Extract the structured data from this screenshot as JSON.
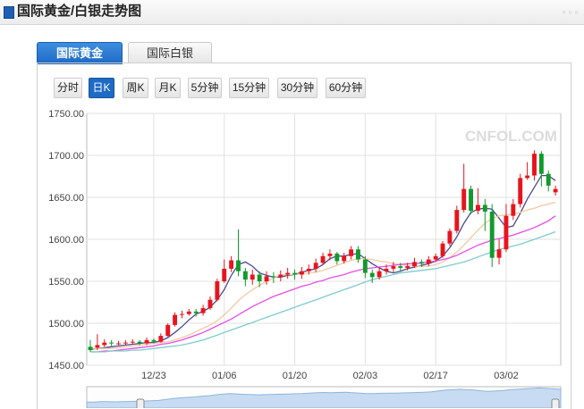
{
  "header": {
    "title": "国际黄金/白银走势图"
  },
  "tabs": [
    {
      "label": "国际黄金",
      "active": true
    },
    {
      "label": "国际白银",
      "active": false
    }
  ],
  "periods": [
    {
      "label": "分时",
      "active": false
    },
    {
      "label": "日K",
      "active": true
    },
    {
      "label": "周K",
      "active": false
    },
    {
      "label": "月K",
      "active": false
    },
    {
      "label": "5分钟",
      "active": false
    },
    {
      "label": "15分钟",
      "active": false
    },
    {
      "label": "30分钟",
      "active": false
    },
    {
      "label": "60分钟",
      "active": false
    }
  ],
  "watermark": {
    "brand": "CNFOL.COM"
  },
  "colors": {
    "up": "#e8141c",
    "down": "#119a2b",
    "ma5": "#4b4b8f",
    "ma10": "#f2c9a0",
    "ma20": "#e84ce8",
    "ma30": "#7ccccc",
    "accent": "#1f6ac4"
  },
  "chart_data": {
    "type": "candlestick",
    "ylim": [
      1450,
      1750
    ],
    "yticks": [
      "1450.00",
      "1500.00",
      "1550.00",
      "1600.00",
      "1650.00",
      "1700.00",
      "1750.00"
    ],
    "xticks": [
      {
        "label": "12/23",
        "index": 9
      },
      {
        "label": "01/06",
        "index": 19
      },
      {
        "label": "01/20",
        "index": 29
      },
      {
        "label": "02/03",
        "index": 39
      },
      {
        "label": "02/17",
        "index": 49
      },
      {
        "label": "03/02",
        "index": 59
      }
    ],
    "candles": [
      [
        1472,
        1468,
        1480,
        1466
      ],
      [
        1471,
        1474,
        1487,
        1468
      ],
      [
        1474,
        1477,
        1481,
        1472
      ],
      [
        1477,
        1476,
        1480,
        1473
      ],
      [
        1476,
        1476,
        1479,
        1474
      ],
      [
        1476,
        1477,
        1480,
        1474
      ],
      [
        1477,
        1478,
        1481,
        1475
      ],
      [
        1478,
        1476,
        1480,
        1474
      ],
      [
        1476,
        1480,
        1483,
        1474
      ],
      [
        1480,
        1478,
        1482,
        1476
      ],
      [
        1478,
        1485,
        1488,
        1477
      ],
      [
        1485,
        1498,
        1500,
        1484
      ],
      [
        1498,
        1510,
        1513,
        1496
      ],
      [
        1510,
        1511,
        1515,
        1506
      ],
      [
        1511,
        1514,
        1517,
        1509
      ],
      [
        1514,
        1512,
        1517,
        1508
      ],
      [
        1512,
        1518,
        1522,
        1509
      ],
      [
        1518,
        1528,
        1532,
        1516
      ],
      [
        1528,
        1550,
        1553,
        1526
      ],
      [
        1550,
        1565,
        1576,
        1548
      ],
      [
        1565,
        1575,
        1580,
        1561
      ],
      [
        1575,
        1562,
        1612,
        1556
      ],
      [
        1562,
        1552,
        1566,
        1544
      ],
      [
        1552,
        1558,
        1564,
        1546
      ],
      [
        1558,
        1550,
        1562,
        1543
      ],
      [
        1550,
        1556,
        1562,
        1546
      ],
      [
        1556,
        1555,
        1561,
        1548
      ],
      [
        1555,
        1558,
        1563,
        1550
      ],
      [
        1558,
        1560,
        1566,
        1553
      ],
      [
        1560,
        1558,
        1564,
        1552
      ],
      [
        1558,
        1562,
        1567,
        1553
      ],
      [
        1562,
        1565,
        1570,
        1558
      ],
      [
        1565,
        1572,
        1577,
        1561
      ],
      [
        1572,
        1580,
        1584,
        1570
      ],
      [
        1580,
        1583,
        1588,
        1575
      ],
      [
        1583,
        1574,
        1585,
        1570
      ],
      [
        1574,
        1580,
        1584,
        1571
      ],
      [
        1580,
        1588,
        1592,
        1576
      ],
      [
        1588,
        1576,
        1592,
        1572
      ],
      [
        1576,
        1560,
        1580,
        1554
      ],
      [
        1560,
        1555,
        1564,
        1548
      ],
      [
        1555,
        1562,
        1567,
        1552
      ],
      [
        1562,
        1565,
        1570,
        1558
      ],
      [
        1565,
        1568,
        1573,
        1561
      ],
      [
        1568,
        1566,
        1572,
        1562
      ],
      [
        1566,
        1568,
        1572,
        1563
      ],
      [
        1568,
        1573,
        1578,
        1566
      ],
      [
        1573,
        1571,
        1576,
        1567
      ],
      [
        1571,
        1576,
        1580,
        1568
      ],
      [
        1576,
        1580,
        1583,
        1573
      ],
      [
        1580,
        1595,
        1598,
        1578
      ],
      [
        1595,
        1610,
        1613,
        1592
      ],
      [
        1610,
        1635,
        1640,
        1607
      ],
      [
        1635,
        1660,
        1690,
        1632
      ],
      [
        1660,
        1634,
        1664,
        1630
      ],
      [
        1634,
        1641,
        1661,
        1630
      ],
      [
        1641,
        1633,
        1648,
        1610
      ],
      [
        1633,
        1578,
        1642,
        1567
      ],
      [
        1578,
        1588,
        1600,
        1570
      ],
      [
        1588,
        1628,
        1642,
        1585
      ],
      [
        1628,
        1642,
        1648,
        1623
      ],
      [
        1642,
        1673,
        1678,
        1638
      ],
      [
        1673,
        1676,
        1692,
        1671
      ],
      [
        1676,
        1702,
        1706,
        1670
      ],
      [
        1702,
        1678,
        1705,
        1663
      ],
      [
        1678,
        1664,
        1682,
        1657
      ],
      [
        1656,
        1660,
        1664,
        1652
      ]
    ],
    "ma_series": [
      {
        "key": "ma5",
        "values": [
          1469,
          1470,
          1471,
          1472,
          1473,
          1474,
          1475,
          1476,
          1477,
          1477,
          1479,
          1483,
          1489,
          1496,
          1504,
          1511,
          1514,
          1519,
          1528,
          1540,
          1557,
          1570,
          1573,
          1568,
          1560,
          1557,
          1555,
          1555,
          1557,
          1558,
          1561,
          1563,
          1565,
          1570,
          1577,
          1580,
          1580,
          1582,
          1583,
          1577,
          1571,
          1566,
          1562,
          1560,
          1562,
          1565,
          1567,
          1569,
          1571,
          1574,
          1580,
          1590,
          1603,
          1619,
          1632,
          1636,
          1637,
          1636,
          1625,
          1614,
          1616,
          1631,
          1648,
          1662,
          1676,
          1676,
          1670
        ]
      },
      {
        "key": "ma10",
        "values": [
          1470,
          1470,
          1470,
          1470,
          1471,
          1472,
          1473,
          1474,
          1475,
          1476,
          1477,
          1478,
          1480,
          1483,
          1486,
          1490,
          1494,
          1498,
          1503,
          1510,
          1518,
          1527,
          1534,
          1540,
          1545,
          1550,
          1554,
          1557,
          1558,
          1558,
          1559,
          1560,
          1561,
          1563,
          1566,
          1569,
          1572,
          1575,
          1577,
          1577,
          1576,
          1574,
          1573,
          1571,
          1570,
          1569,
          1568,
          1568,
          1568,
          1570,
          1573,
          1578,
          1585,
          1593,
          1602,
          1611,
          1619,
          1625,
          1628,
          1629,
          1630,
          1632,
          1635,
          1637,
          1640,
          1642,
          1644
        ]
      },
      {
        "key": "ma20",
        "values": [
          1466,
          1466,
          1467,
          1467,
          1468,
          1469,
          1470,
          1471,
          1472,
          1473,
          1475,
          1476,
          1478,
          1480,
          1483,
          1486,
          1489,
          1493,
          1497,
          1501,
          1505,
          1510,
          1515,
          1520,
          1524,
          1528,
          1532,
          1535,
          1538,
          1541,
          1544,
          1546,
          1549,
          1551,
          1554,
          1556,
          1558,
          1561,
          1563,
          1565,
          1566,
          1567,
          1568,
          1569,
          1570,
          1571,
          1571,
          1572,
          1573,
          1574,
          1576,
          1578,
          1581,
          1585,
          1589,
          1593,
          1596,
          1599,
          1601,
          1603,
          1605,
          1608,
          1611,
          1614,
          1618,
          1622,
          1628
        ]
      },
      {
        "key": "ma30",
        "values": [
          1466,
          1466,
          1466,
          1467,
          1467,
          1467,
          1468,
          1468,
          1469,
          1470,
          1471,
          1472,
          1473,
          1474,
          1476,
          1478,
          1480,
          1483,
          1486,
          1489,
          1492,
          1495,
          1498,
          1501,
          1504,
          1507,
          1510,
          1513,
          1516,
          1519,
          1522,
          1525,
          1528,
          1531,
          1534,
          1537,
          1540,
          1543,
          1546,
          1549,
          1552,
          1554,
          1556,
          1558,
          1560,
          1561,
          1562,
          1563,
          1564,
          1565,
          1567,
          1569,
          1571,
          1573,
          1576,
          1579,
          1582,
          1585,
          1588,
          1590,
          1592,
          1594,
          1597,
          1600,
          1603,
          1606,
          1609
        ]
      }
    ],
    "navigator": [
      0.28,
      0.28,
      0.3,
      0.3,
      0.29,
      0.3,
      0.31,
      0.32,
      0.33,
      0.34,
      0.36,
      0.4,
      0.45,
      0.48,
      0.5,
      0.52,
      0.55,
      0.58,
      0.62,
      0.66,
      0.68,
      0.66,
      0.64,
      0.63,
      0.62,
      0.63,
      0.64,
      0.65,
      0.66,
      0.67,
      0.68,
      0.7,
      0.72,
      0.73,
      0.72,
      0.73,
      0.74,
      0.72,
      0.7,
      0.68,
      0.68,
      0.69,
      0.7,
      0.7,
      0.71,
      0.72,
      0.73,
      0.74,
      0.76,
      0.8,
      0.84,
      0.86,
      0.88,
      0.86,
      0.84,
      0.8,
      0.78,
      0.8,
      0.82,
      0.86,
      0.88,
      0.9,
      0.92,
      0.94,
      0.92,
      0.9,
      0.88
    ]
  }
}
